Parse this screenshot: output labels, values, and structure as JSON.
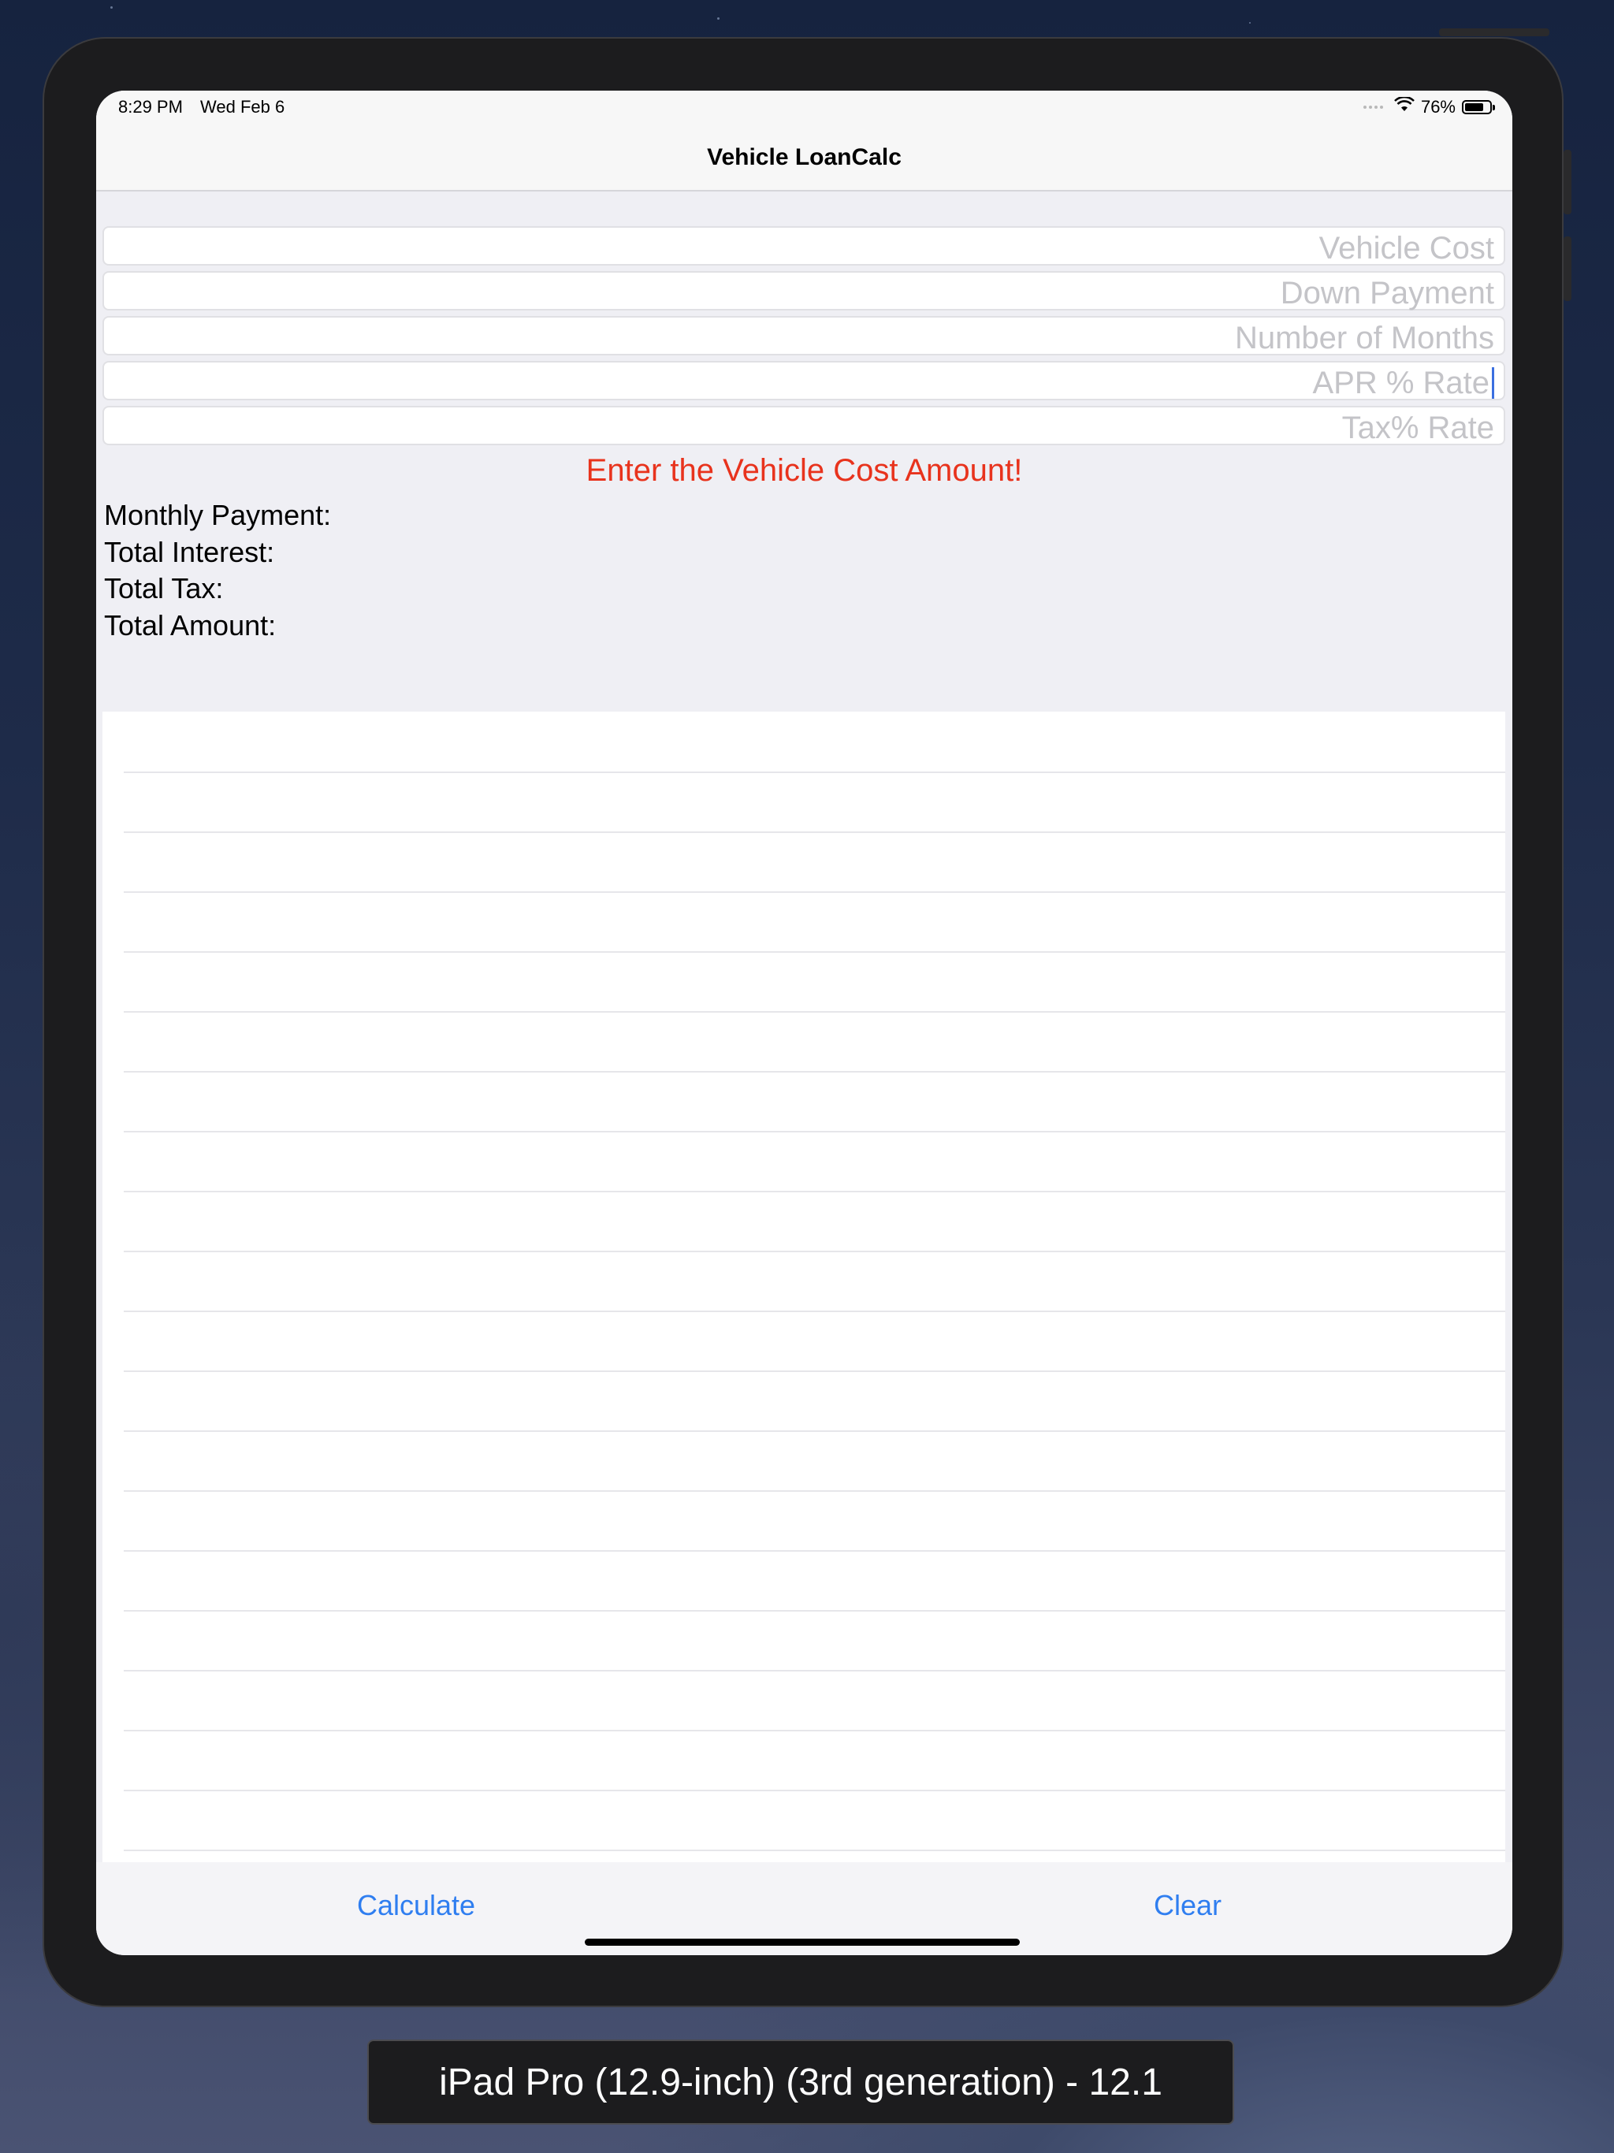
{
  "status_bar": {
    "time": "8:29 PM",
    "date": "Wed Feb 6",
    "battery_percent": "76%",
    "battery_level": 0.76,
    "wifi_icon": "wifi-icon"
  },
  "nav": {
    "title": "Vehicle LoanCalc"
  },
  "form": {
    "vehicle_cost_placeholder": "Vehicle Cost",
    "down_payment_placeholder": "Down Payment",
    "months_placeholder": "Number of Months",
    "apr_placeholder": "APR % Rate",
    "tax_placeholder": "Tax% Rate"
  },
  "error_message": "Enter the Vehicle Cost Amount!",
  "results": {
    "monthly_payment_label": "Monthly Payment:",
    "total_interest_label": "Total Interest:",
    "total_tax_label": "Total Tax:",
    "total_amount_label": "Total Amount:"
  },
  "toolbar": {
    "calculate_label": "Calculate",
    "clear_label": "Clear"
  },
  "device_label": "iPad Pro (12.9-inch) (3rd generation) - 12.1",
  "colors": {
    "error": "#e8331d",
    "accent": "#2f7ef0",
    "placeholder": "#c4c4c8"
  }
}
